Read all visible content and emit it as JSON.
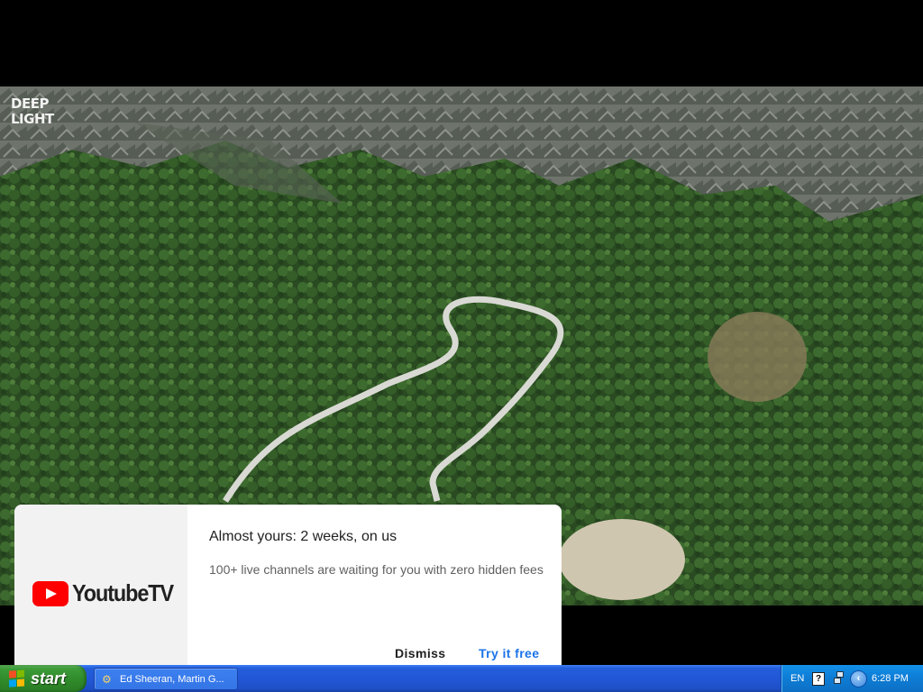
{
  "video": {
    "watermark": [
      "DEEP",
      "LIGHT"
    ]
  },
  "promo": {
    "brand_wordmark": "YoutubeTV",
    "title": "Almost yours: 2 weeks, on us",
    "description": "100+ live channels are waiting for you with zero hidden fees",
    "dismiss_label": "Dismiss",
    "try_label": "Try it free",
    "colors": {
      "accent": "#1a73e8",
      "brand_red": "#ff0000"
    }
  },
  "taskbar": {
    "start_label": "start",
    "task_item_label": "Ed Sheeran, Martin G...",
    "task_item_icon": "media-player-icon",
    "tray": {
      "language": "EN",
      "help_icon": "?",
      "chevron_icon": "‹",
      "clock": "6:28 PM"
    }
  }
}
